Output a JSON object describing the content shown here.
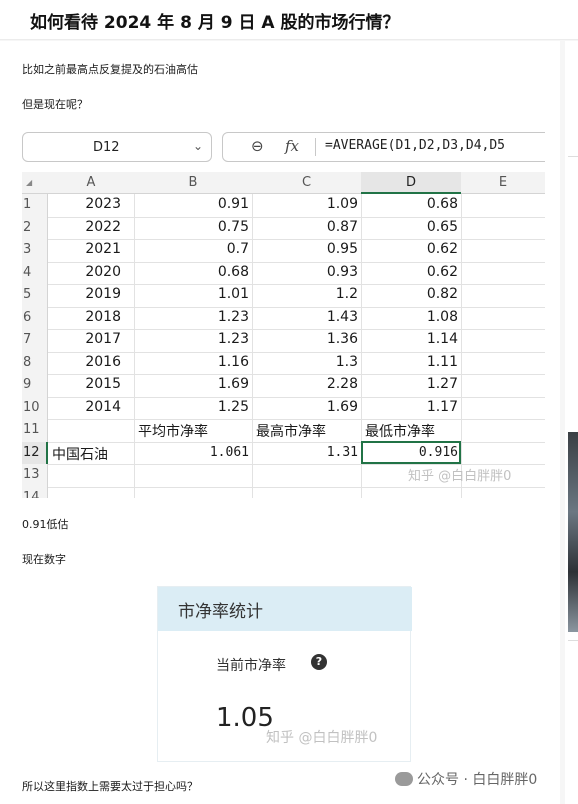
{
  "header": {
    "title": "如何看待 2024 年 8 月 9 日 A 股的市场行情？"
  },
  "article": {
    "para1": "比如之前最高点反复提及的石油高估",
    "para2": "但是现在呢？",
    "para3": "0.91低估",
    "para4": "现在数字",
    "para5": "所以这里指数上需要太过于担心吗？"
  },
  "excel": {
    "name_box": "D12",
    "formula": "=AVERAGE(D1,D2,D3,D4,D5",
    "columns": [
      "A",
      "B",
      "C",
      "D",
      "E"
    ],
    "row_numbers": [
      "1",
      "2",
      "3",
      "4",
      "5",
      "6",
      "7",
      "8",
      "9",
      "10",
      "11",
      "12",
      "13",
      "14"
    ],
    "rows": [
      [
        "2023",
        "0.91",
        "1.09",
        "0.68"
      ],
      [
        "2022",
        "0.75",
        "0.87",
        "0.65"
      ],
      [
        "2021",
        "0.7",
        "0.95",
        "0.62"
      ],
      [
        "2020",
        "0.68",
        "0.93",
        "0.62"
      ],
      [
        "2019",
        "1.01",
        "1.2",
        "0.82"
      ],
      [
        "2018",
        "1.23",
        "1.43",
        "1.08"
      ],
      [
        "2017",
        "1.23",
        "1.36",
        "1.14"
      ],
      [
        "2016",
        "1.16",
        "1.3",
        "1.11"
      ],
      [
        "2015",
        "1.69",
        "2.28",
        "1.27"
      ],
      [
        "2014",
        "1.25",
        "1.69",
        "1.17"
      ]
    ],
    "row11": [
      "平均市净率",
      "最高市净率",
      "最低市净率"
    ],
    "row12": [
      "中国石油",
      "1.061",
      "1.31",
      "0.916"
    ],
    "watermark": "知乎 @白白胖胖0"
  },
  "card": {
    "title": "市净率统计",
    "label": "当前市净率",
    "value": "1.05",
    "watermark": "知乎 @白白胖胖0"
  },
  "footer": {
    "wechat": "公众号 · 白白胖胖0"
  },
  "colors": {
    "excel_selection": "#217346",
    "card_header": "#dbedf5"
  }
}
